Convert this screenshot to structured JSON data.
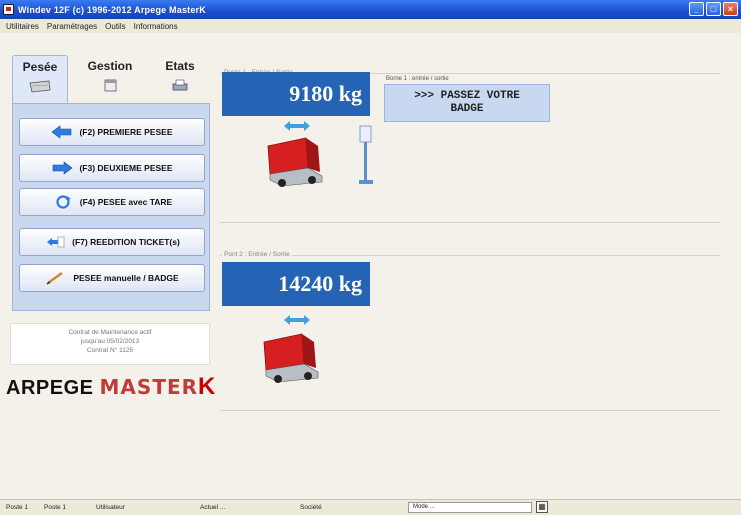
{
  "window": {
    "title": "Windev 12F (c) 1996-2012 Arpege MasterK",
    "controls": [
      "minimize",
      "maximize",
      "close"
    ]
  },
  "menu": {
    "items": [
      "Utilitaires",
      "Paramétrages",
      "Outils",
      "Informations"
    ]
  },
  "tabs": [
    {
      "label": "Pesée",
      "icon": "scale-icon",
      "active": true
    },
    {
      "label": "Gestion",
      "icon": "calendar-icon",
      "active": false
    },
    {
      "label": "Etats",
      "icon": "printer-icon",
      "active": false
    }
  ],
  "actions": [
    {
      "label": "(F2) PREMIERE PESEE",
      "icon": "arrow-left-icon"
    },
    {
      "label": "(F3) DEUXIEME PESEE",
      "icon": "arrow-right-icon"
    },
    {
      "label": "(F4) PESEE avec TARE",
      "icon": "refresh-icon"
    },
    {
      "label": "(F7) REEDITION TICKET(s)",
      "icon": "reprint-icon"
    },
    {
      "label": "PESEE manuelle / BADGE",
      "icon": "pen-icon"
    }
  ],
  "info": {
    "line1": "Contrat de Maintenance actif",
    "line2": "jusqu'au 05/02/2013",
    "line3": "Contrat N° 1125"
  },
  "logo": {
    "part1": "ARPEGE ",
    "part2": "MASTER",
    "part3": "K"
  },
  "stations": [
    {
      "label": "Poste 1 : Entrée / Sortie",
      "weight": "9180 kg",
      "message_label": "Borne 1 : entrée / sortie",
      "message_line1": ">>> PASSEZ VOTRE",
      "message_line2": "BADGE"
    },
    {
      "label": "Pont 2 : Entrée / Sortie",
      "weight": "14240 kg"
    }
  ],
  "status": {
    "cells": [
      "Poste 1",
      "Poste 1",
      "Utilisateur",
      "Actuel ...",
      "Société"
    ],
    "combo_value": "Mode ...",
    "icon": "calendar-icon"
  },
  "colors": {
    "titlebar": "#1a4fd0",
    "weight_bg": "#2564b5",
    "panel_bg": "#c9d7ef",
    "logo_red": "#c00000"
  }
}
